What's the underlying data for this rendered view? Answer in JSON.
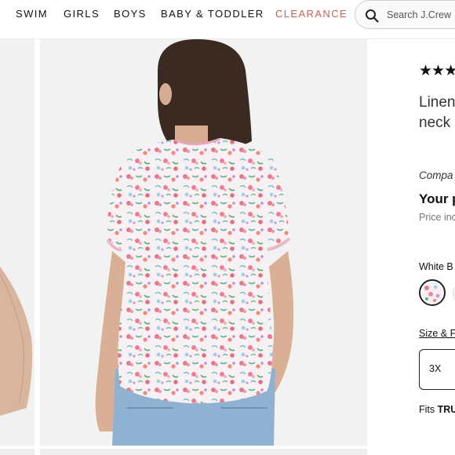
{
  "nav": {
    "items": [
      "SWIM",
      "GIRLS",
      "BOYS",
      "BABY & TODDLER"
    ],
    "clearance": "CLEARANCE",
    "clearance_color": "#c4625a"
  },
  "search": {
    "placeholder": "Search J.Crew",
    "icon": "search-icon"
  },
  "product": {
    "stars": "★★★",
    "title_line1": "Linen",
    "title_line2": "neck",
    "compare_label": "Compa",
    "your_price_label": "Your p",
    "price_note": "Price inc",
    "color_name": "White B",
    "size_fit_link": "Size & F",
    "selected_size": "3X",
    "fits_prefix": "Fits ",
    "fits_value": "TRU"
  }
}
